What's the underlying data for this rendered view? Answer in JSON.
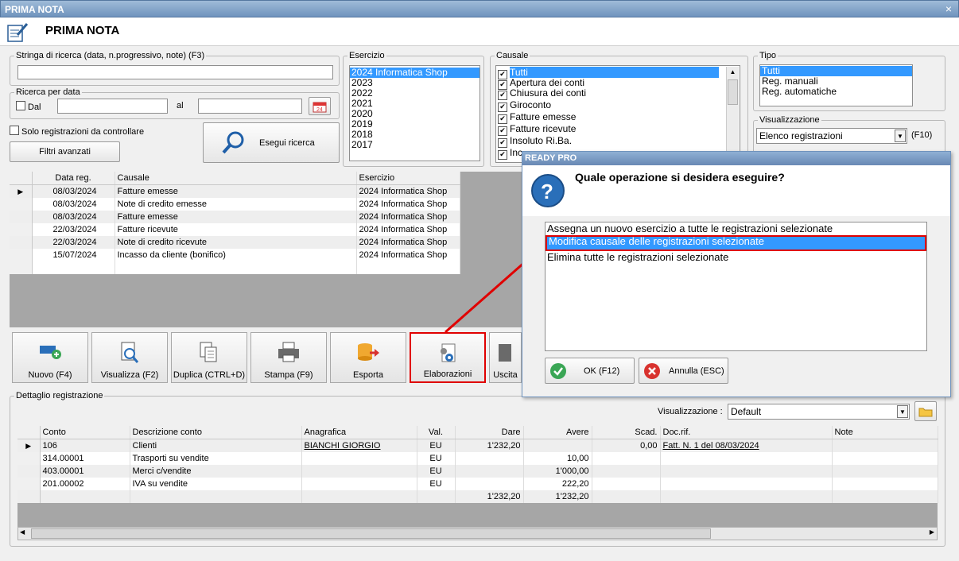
{
  "window": {
    "title": "PRIMA NOTA",
    "close": "×",
    "page_title": "PRIMA NOTA"
  },
  "search": {
    "label": "Stringa di ricerca (data, n.progressivo, note) (F3)",
    "value": ""
  },
  "date_search": {
    "label": "Ricerca per data",
    "dal": "Dal",
    "al": "al",
    "dal_value": "",
    "al_value": ""
  },
  "solo_label": "Solo registrazioni da controllare",
  "filtri_label": "Filtri avanzati",
  "esegui_label": "Esegui ricerca",
  "esercizio": {
    "label": "Esercizio",
    "items": [
      "2024 Informatica Shop",
      "2023",
      "2022",
      "2021",
      "2020",
      "2019",
      "2018",
      "2017"
    ],
    "selected": 0
  },
  "causale": {
    "label": "Causale",
    "items": [
      "Tutti",
      "Apertura dei conti",
      "Chiusura dei conti",
      "Giroconto",
      "Fatture emesse",
      "Fatture ricevute",
      "Insoluto Ri.Ba.",
      "Inc"
    ],
    "selected": 0
  },
  "tipo": {
    "label": "Tipo",
    "items": [
      "Tutti",
      "Reg. manuali",
      "Reg. automatiche"
    ],
    "selected": 0
  },
  "visualizzazione_top": {
    "label": "Visualizzazione",
    "value": "Elenco registrazioni",
    "shortcut": "(F10)"
  },
  "registrations": {
    "headers": [
      "Data reg.",
      "Causale",
      "Esercizio"
    ],
    "rows": [
      [
        "08/03/2024",
        "Fatture emesse",
        "2024 Informatica Shop"
      ],
      [
        "08/03/2024",
        "Note di credito emesse",
        "2024 Informatica Shop"
      ],
      [
        "08/03/2024",
        "Fatture emesse",
        "2024 Informatica Shop"
      ],
      [
        "22/03/2024",
        "Fatture ricevute",
        "2024 Informatica Shop"
      ],
      [
        "22/03/2024",
        "Note di credito ricevute",
        "2024 Informatica Shop"
      ],
      [
        "15/07/2024",
        "Incasso da cliente (bonifico)",
        "2024 Informatica Shop"
      ]
    ]
  },
  "toolbar": [
    {
      "label": "Nuovo (F4)",
      "icon": "new-card-icon"
    },
    {
      "label": "Visualizza (F2)",
      "icon": "view-document-icon"
    },
    {
      "label": "Duplica (CTRL+D)",
      "icon": "duplicate-icon"
    },
    {
      "label": "Stampa (F9)",
      "icon": "printer-icon"
    },
    {
      "label": "Esporta",
      "icon": "export-icon"
    },
    {
      "label": "Elaborazioni",
      "icon": "gear-document-icon"
    },
    {
      "label": "Uscita",
      "icon": "exit-icon"
    }
  ],
  "dettaglio": {
    "label": "Dettaglio registrazione",
    "vis_label": "Visualizzazione :",
    "vis_value": "Default",
    "headers": [
      "Conto",
      "Descrizione conto",
      "Anagrafica",
      "Val.",
      "Dare",
      "Avere",
      "Scad.",
      "Doc.rif.",
      "Note"
    ],
    "rows": [
      [
        "106",
        "Clienti",
        "BIANCHI GIORGIO",
        "EU",
        "1'232,20",
        "",
        "0,00",
        "Fatt. N. 1 del 08/03/2024",
        ""
      ],
      [
        "314.00001",
        "Trasporti su vendite",
        "",
        "EU",
        "",
        "10,00",
        "",
        "",
        ""
      ],
      [
        "403.00001",
        "Merci c/vendite",
        "",
        "EU",
        "",
        "1'000,00",
        "",
        "",
        ""
      ],
      [
        "201.00002",
        "IVA su vendite",
        "",
        "EU",
        "",
        "222,20",
        "",
        "",
        ""
      ],
      [
        "",
        "",
        "",
        "",
        "1'232,20",
        "1'232,20",
        "",
        "",
        ""
      ]
    ]
  },
  "dialog": {
    "title": "READY PRO",
    "question": "Quale operazione si desidera eseguire?",
    "options": [
      "Assegna un nuovo esercizio a tutte le registrazioni selezionate",
      "Modifica causale delle registrazioni selezionate",
      "Elimina tutte le registrazioni selezionate"
    ],
    "selected": 1,
    "ok_label": "OK (F12)",
    "cancel_label": "Annulla (ESC)"
  },
  "colors": {
    "accent": "#3399ff",
    "highlight": "#e00000"
  }
}
